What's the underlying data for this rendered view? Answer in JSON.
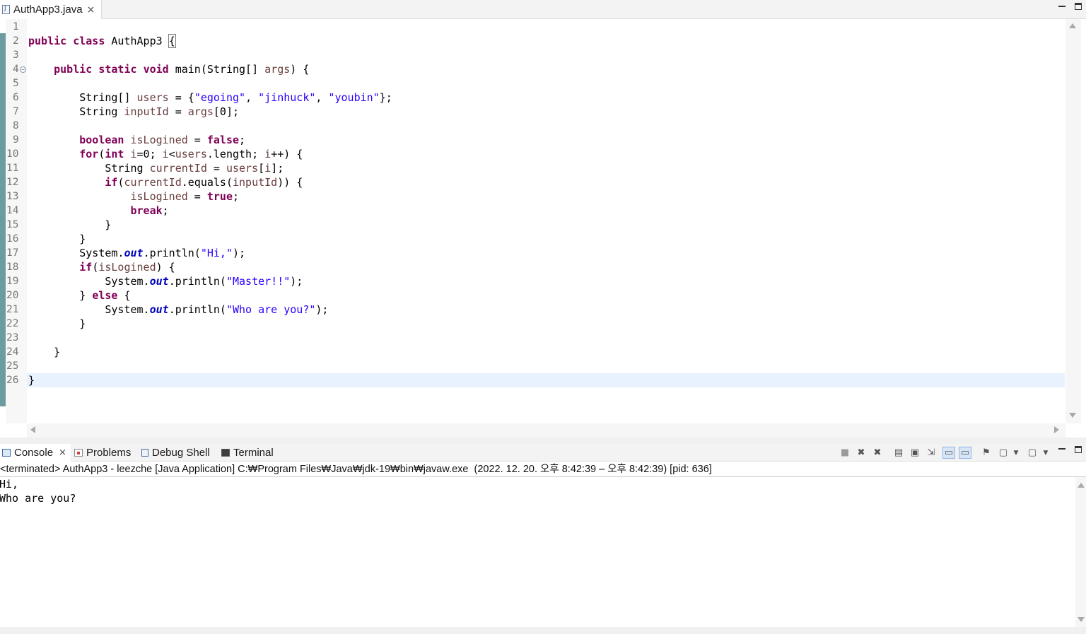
{
  "editor": {
    "tab": {
      "title": "AuthApp3.java",
      "close_icon": "×"
    },
    "window_controls": [
      "minimize",
      "maximize"
    ],
    "line_numbers": [
      "1",
      "2",
      "3",
      "4",
      "5",
      "6",
      "7",
      "8",
      "9",
      "10",
      "11",
      "12",
      "13",
      "14",
      "15",
      "16",
      "17",
      "18",
      "19",
      "20",
      "21",
      "22",
      "23",
      "24",
      "25",
      "26"
    ],
    "current_line": 26,
    "code_lines": [
      [],
      [
        {
          "t": "kw",
          "v": "public"
        },
        {
          "t": "p",
          "v": " "
        },
        {
          "t": "kw",
          "v": "class"
        },
        {
          "t": "p",
          "v": " AuthApp3 "
        },
        {
          "t": "box",
          "v": "{"
        }
      ],
      [],
      [
        {
          "t": "p",
          "v": "    "
        },
        {
          "t": "kw",
          "v": "public"
        },
        {
          "t": "p",
          "v": " "
        },
        {
          "t": "kw",
          "v": "static"
        },
        {
          "t": "p",
          "v": " "
        },
        {
          "t": "kw",
          "v": "void"
        },
        {
          "t": "p",
          "v": " main(String[] "
        },
        {
          "t": "var",
          "v": "args"
        },
        {
          "t": "p",
          "v": ") {"
        }
      ],
      [],
      [
        {
          "t": "p",
          "v": "        String[] "
        },
        {
          "t": "var",
          "v": "users"
        },
        {
          "t": "p",
          "v": " = {"
        },
        {
          "t": "str",
          "v": "\"egoing\""
        },
        {
          "t": "p",
          "v": ", "
        },
        {
          "t": "str",
          "v": "\"jinhuck\""
        },
        {
          "t": "p",
          "v": ", "
        },
        {
          "t": "str",
          "v": "\"youbin\""
        },
        {
          "t": "p",
          "v": "};"
        }
      ],
      [
        {
          "t": "p",
          "v": "        String "
        },
        {
          "t": "var",
          "v": "inputId"
        },
        {
          "t": "p",
          "v": " = "
        },
        {
          "t": "var",
          "v": "args"
        },
        {
          "t": "p",
          "v": "[0];"
        }
      ],
      [],
      [
        {
          "t": "p",
          "v": "        "
        },
        {
          "t": "kw",
          "v": "boolean"
        },
        {
          "t": "p",
          "v": " "
        },
        {
          "t": "var",
          "v": "isLogined"
        },
        {
          "t": "p",
          "v": " = "
        },
        {
          "t": "kw",
          "v": "false"
        },
        {
          "t": "p",
          "v": ";"
        }
      ],
      [
        {
          "t": "p",
          "v": "        "
        },
        {
          "t": "kw",
          "v": "for"
        },
        {
          "t": "p",
          "v": "("
        },
        {
          "t": "kw",
          "v": "int"
        },
        {
          "t": "p",
          "v": " "
        },
        {
          "t": "var",
          "v": "i"
        },
        {
          "t": "p",
          "v": "=0; "
        },
        {
          "t": "var",
          "v": "i"
        },
        {
          "t": "p",
          "v": "<"
        },
        {
          "t": "var",
          "v": "users"
        },
        {
          "t": "p",
          "v": ".length; "
        },
        {
          "t": "var",
          "v": "i"
        },
        {
          "t": "p",
          "v": "++) {"
        }
      ],
      [
        {
          "t": "p",
          "v": "            String "
        },
        {
          "t": "var",
          "v": "currentId"
        },
        {
          "t": "p",
          "v": " = "
        },
        {
          "t": "var",
          "v": "users"
        },
        {
          "t": "p",
          "v": "["
        },
        {
          "t": "var",
          "v": "i"
        },
        {
          "t": "p",
          "v": "];"
        }
      ],
      [
        {
          "t": "p",
          "v": "            "
        },
        {
          "t": "kw",
          "v": "if"
        },
        {
          "t": "p",
          "v": "("
        },
        {
          "t": "var",
          "v": "currentId"
        },
        {
          "t": "p",
          "v": ".equals("
        },
        {
          "t": "var",
          "v": "inputId"
        },
        {
          "t": "p",
          "v": ")) {"
        }
      ],
      [
        {
          "t": "p",
          "v": "                "
        },
        {
          "t": "var",
          "v": "isLogined"
        },
        {
          "t": "p",
          "v": " = "
        },
        {
          "t": "kw",
          "v": "true"
        },
        {
          "t": "p",
          "v": ";"
        }
      ],
      [
        {
          "t": "p",
          "v": "                "
        },
        {
          "t": "kw",
          "v": "break"
        },
        {
          "t": "p",
          "v": ";"
        }
      ],
      [
        {
          "t": "p",
          "v": "            }"
        }
      ],
      [
        {
          "t": "p",
          "v": "        }"
        }
      ],
      [
        {
          "t": "p",
          "v": "        System."
        },
        {
          "t": "fld",
          "v": "out"
        },
        {
          "t": "p",
          "v": ".println("
        },
        {
          "t": "str",
          "v": "\"Hi,\""
        },
        {
          "t": "p",
          "v": ");"
        }
      ],
      [
        {
          "t": "p",
          "v": "        "
        },
        {
          "t": "kw",
          "v": "if"
        },
        {
          "t": "p",
          "v": "("
        },
        {
          "t": "var",
          "v": "isLogined"
        },
        {
          "t": "p",
          "v": ") {"
        }
      ],
      [
        {
          "t": "p",
          "v": "            System."
        },
        {
          "t": "fld",
          "v": "out"
        },
        {
          "t": "p",
          "v": ".println("
        },
        {
          "t": "str",
          "v": "\"Master!!\""
        },
        {
          "t": "p",
          "v": ");"
        }
      ],
      [
        {
          "t": "p",
          "v": "        } "
        },
        {
          "t": "kw",
          "v": "else"
        },
        {
          "t": "p",
          "v": " {"
        }
      ],
      [
        {
          "t": "p",
          "v": "            System."
        },
        {
          "t": "fld",
          "v": "out"
        },
        {
          "t": "p",
          "v": ".println("
        },
        {
          "t": "str",
          "v": "\"Who are you?\""
        },
        {
          "t": "p",
          "v": ");"
        }
      ],
      [
        {
          "t": "p",
          "v": "        }"
        }
      ],
      [],
      [
        {
          "t": "p",
          "v": "    }"
        }
      ],
      [],
      [
        {
          "t": "p",
          "v": "}"
        }
      ]
    ],
    "colors": {
      "keyword": "#7f0055",
      "string": "#2a00ff",
      "variable": "#6a3e3e",
      "field": "#0000c0",
      "current_line_bg": "#e8f2fe"
    }
  },
  "console": {
    "tabs": [
      {
        "label": "Console",
        "icon": "console-icon",
        "active": true,
        "closable": true
      },
      {
        "label": "Problems",
        "icon": "problems-icon",
        "active": false
      },
      {
        "label": "Debug Shell",
        "icon": "debug-shell-icon",
        "active": false
      },
      {
        "label": "Terminal",
        "icon": "terminal-icon",
        "active": false
      }
    ],
    "toolbar_icons": [
      "terminate-icon",
      "remove-launch-icon",
      "remove-all-terminated-icon",
      "clear-console-icon",
      "scroll-lock-icon",
      "word-wrap-icon",
      "show-on-stdout-icon",
      "show-on-stderr-icon",
      "pin-console-icon",
      "display-selected-console-icon",
      "open-console-icon",
      "view-menu-icon",
      "minimize-icon",
      "maximize-icon"
    ],
    "header": "<terminated> AuthApp3 - leezche [Java Application] C:₩Program Files₩Java₩jdk-19₩bin₩javaw.exe  (2022. 12. 20. 오후 8:42:39 – 오후 8:42:39) [pid: 636]",
    "output": [
      "Hi,",
      "Who are you?"
    ]
  }
}
